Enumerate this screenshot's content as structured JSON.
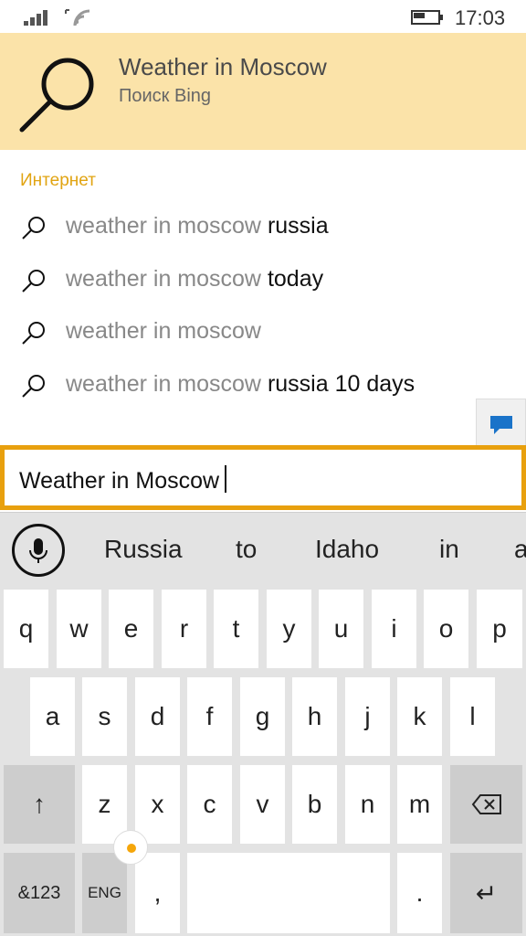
{
  "status": {
    "time": "17:03",
    "signal_icon": "signal-bars-icon",
    "wifi_icon": "wifi-icon",
    "battery_icon": "battery-icon"
  },
  "top_suggestion": {
    "title": "Weather in Moscow",
    "subtitle": "Поиск Bing",
    "icon": "search-icon"
  },
  "section": {
    "label": "Интернет"
  },
  "suggestions": [
    {
      "typed": "weather in moscow ",
      "completion": "russia"
    },
    {
      "typed": "weather in moscow ",
      "completion": "today"
    },
    {
      "typed": "weather in moscow",
      "completion": ""
    },
    {
      "typed": "weather in moscow ",
      "completion": "russia 10 days"
    }
  ],
  "feedback": {
    "icon": "chat-bubble-icon",
    "color": "#1a73c9"
  },
  "search_box": {
    "value": "Weather in Moscow",
    "accent": "#e8a00e"
  },
  "keyboard": {
    "mic_icon": "microphone-icon",
    "predictions": [
      "Russia",
      "to",
      "Idaho",
      "in",
      "a"
    ],
    "row1": [
      "q",
      "w",
      "e",
      "r",
      "t",
      "y",
      "u",
      "i",
      "o",
      "p"
    ],
    "row2": [
      "a",
      "s",
      "d",
      "f",
      "g",
      "h",
      "j",
      "k",
      "l"
    ],
    "row3": [
      "z",
      "x",
      "c",
      "v",
      "b",
      "n",
      "m"
    ],
    "shift_label": "↑",
    "backspace_icon": "backspace-icon",
    "numbers_label": "&123",
    "lang_label": "ENG",
    "comma_label": ",",
    "period_label": ".",
    "enter_label": "↵",
    "emoji_indicator_color": "#f5a60a"
  }
}
